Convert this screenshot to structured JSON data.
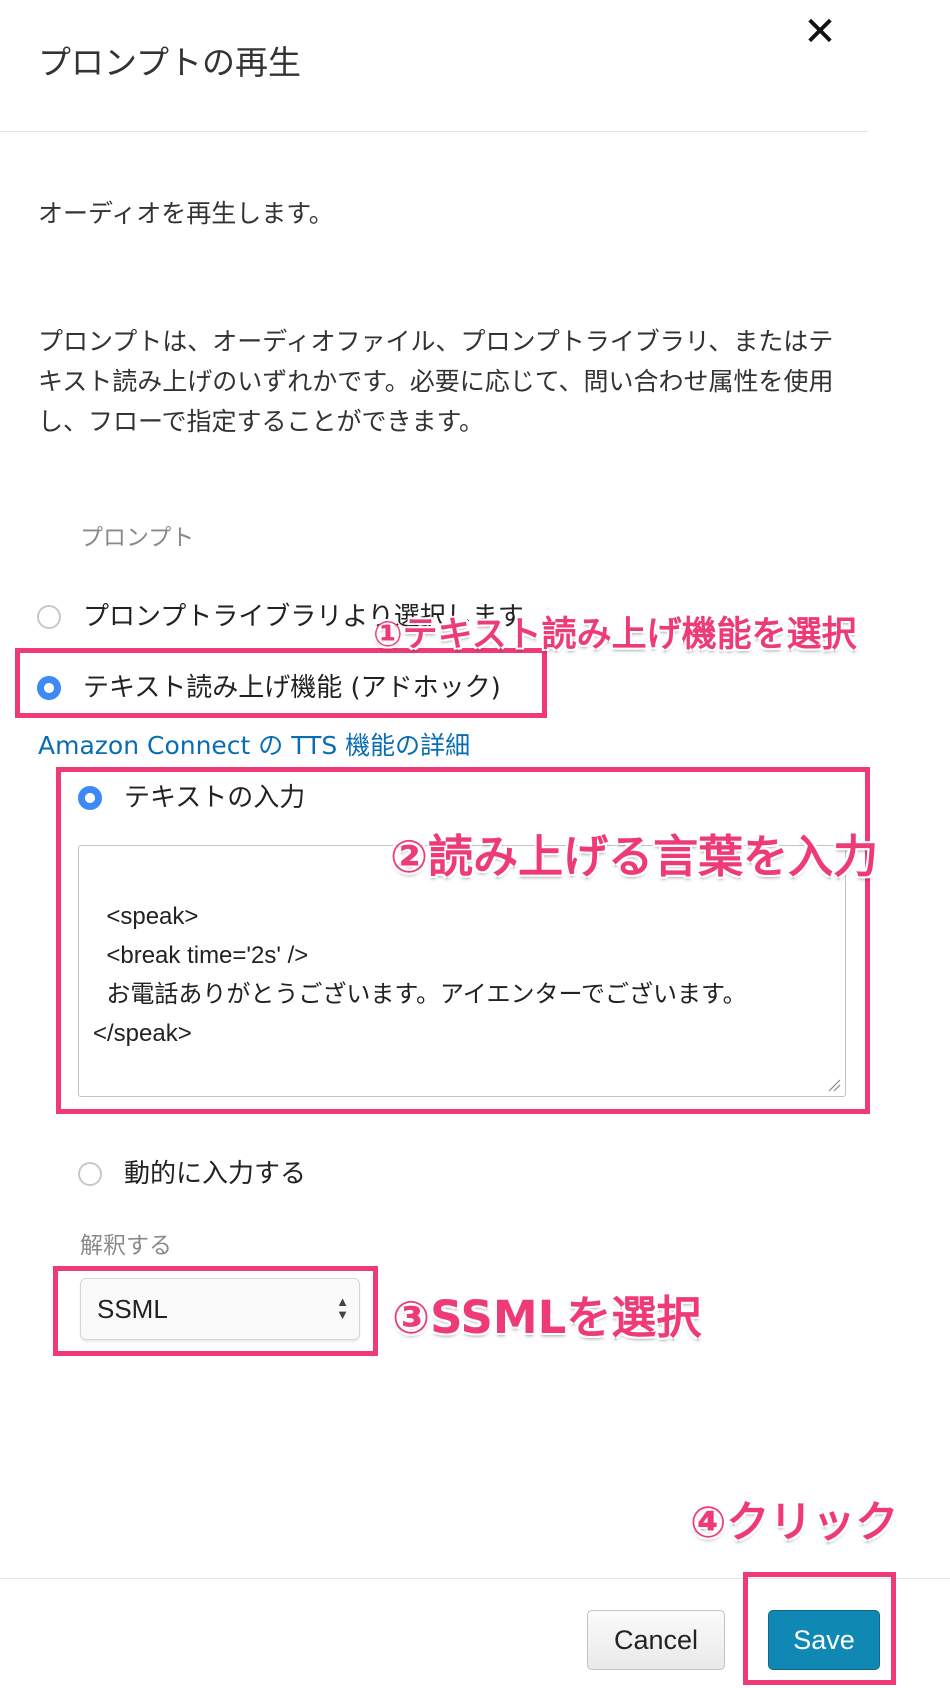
{
  "dialog": {
    "title": "プロンプトの再生",
    "close_label": "✕",
    "description": "オーディオを再生します。",
    "detail": "プロンプトは、オーディオファイル、プロンプトライブラリ、またはテキスト読み上げのいずれかです。必要に応じて、問い合わせ属性を使用し、フローで指定することができます。"
  },
  "prompt": {
    "label": "プロンプト",
    "options": [
      {
        "label": "プロンプトライブラリより選択します",
        "selected": false
      },
      {
        "label": "テキスト読み上げ機能 (アドホック)",
        "selected": true
      }
    ],
    "tts_link": "Amazon Connect の TTS 機能の詳細",
    "text_options": [
      {
        "label": "テキストの入力",
        "selected": true
      },
      {
        "label": "動的に入力する",
        "selected": false
      }
    ],
    "text_value": "<speak>\n  <break time='2s' />\n  お電話ありがとうございます。アイエンターでございます。\n</speak>",
    "interpret_label": "解釈する",
    "interpret_value": "SSML"
  },
  "footer": {
    "cancel_label": "Cancel",
    "save_label": "Save"
  },
  "annotations": {
    "step1": "①テキスト読み上げ機能を選択",
    "step2": "②読み上げる言葉を入力",
    "step3": "③SSMLを選択",
    "step4": "④クリック",
    "color": "#ee3a78"
  },
  "colors": {
    "radio_selected": "#3d8af7",
    "link": "#0a6db3",
    "save_button": "#0f88b4"
  }
}
